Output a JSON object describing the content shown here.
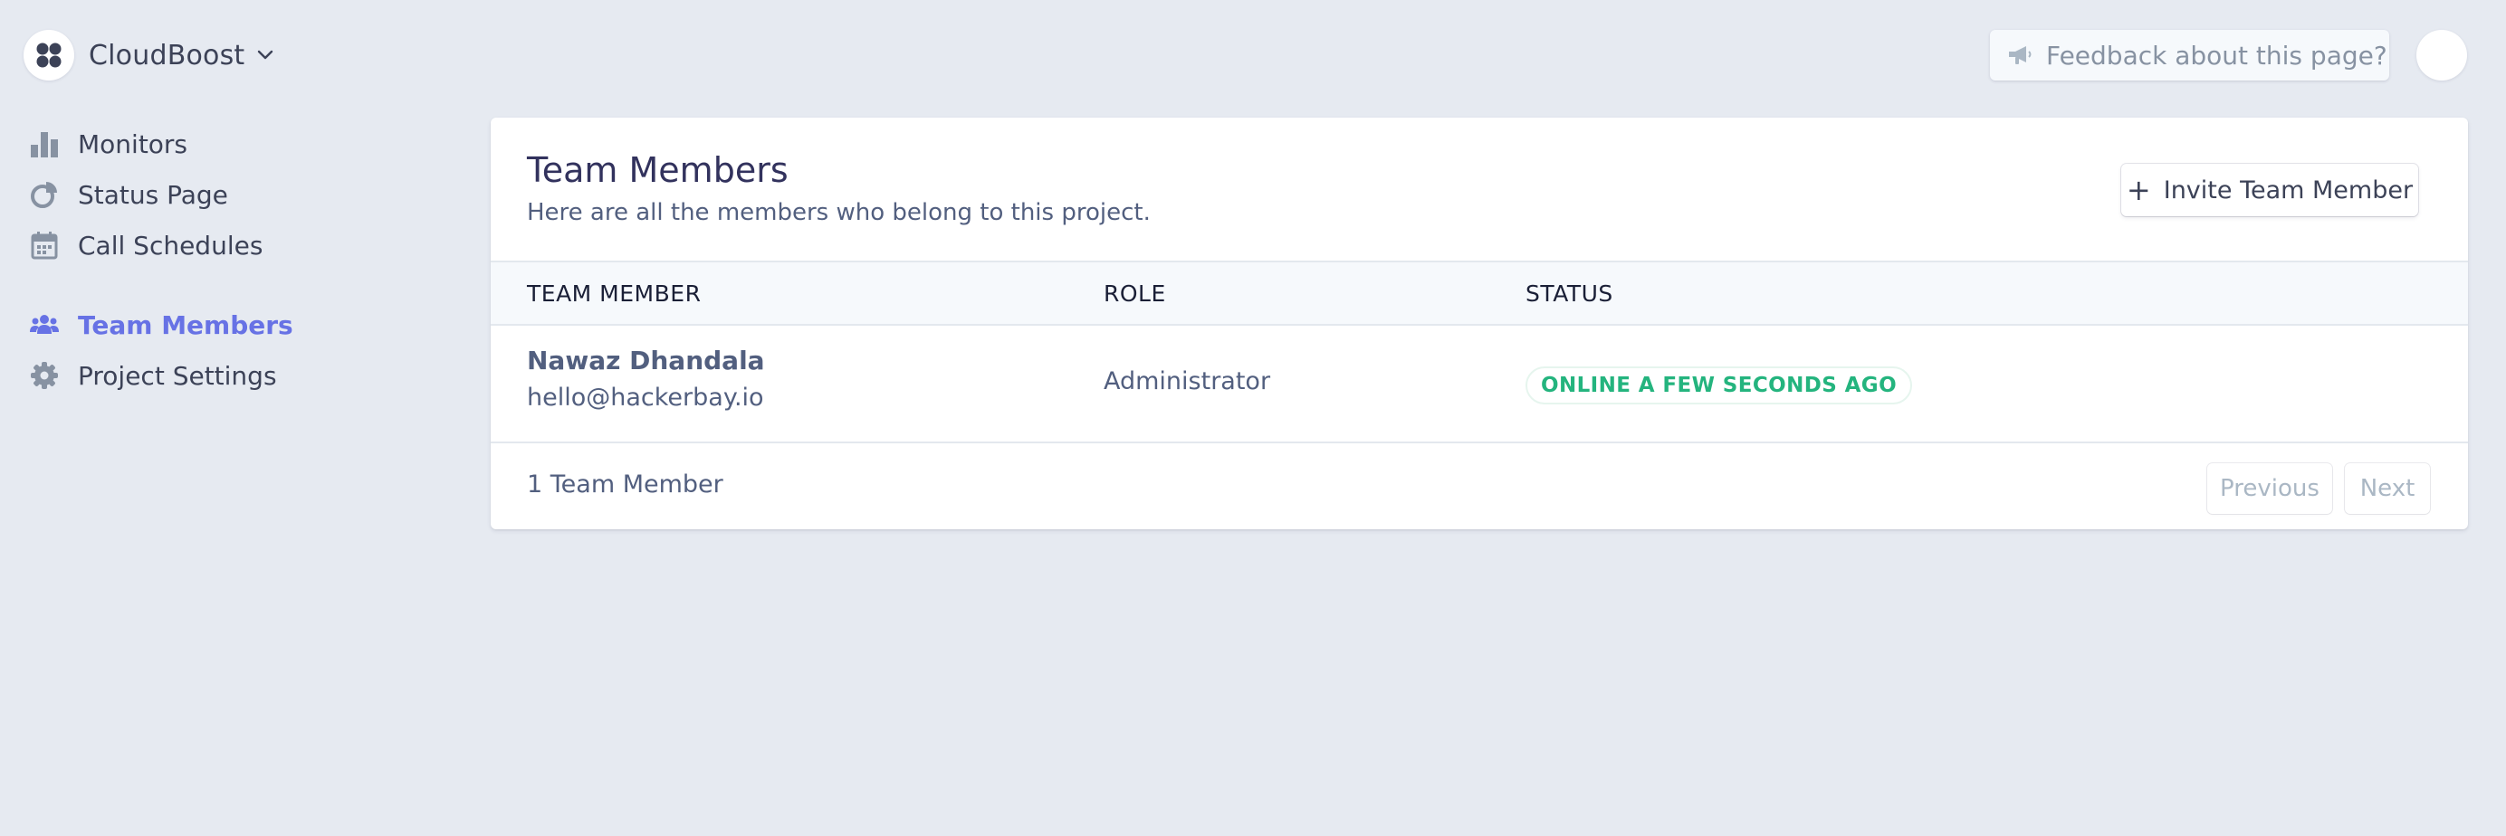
{
  "header": {
    "project_name": "CloudBoost",
    "feedback_placeholder": "Feedback about this page?"
  },
  "sidebar": {
    "items": [
      {
        "label": "Monitors",
        "icon": "bar-chart-icon"
      },
      {
        "label": "Status Page",
        "icon": "status-page-icon"
      },
      {
        "label": "Call Schedules",
        "icon": "calendar-icon"
      },
      {
        "label": "Team Members",
        "icon": "team-icon",
        "active": true
      },
      {
        "label": "Project Settings",
        "icon": "gear-icon"
      }
    ]
  },
  "main": {
    "title": "Team Members",
    "subtitle": "Here are all the members who belong to this project.",
    "invite_button": "Invite Team Member",
    "columns": [
      "TEAM MEMBER",
      "ROLE",
      "STATUS"
    ],
    "rows": [
      {
        "name": "Nawaz Dhandala",
        "email": "hello@hackerbay.io",
        "role": "Administrator",
        "status": "ONLINE A FEW SECONDS AGO"
      }
    ],
    "footer_count": "1 Team Member",
    "pagination": {
      "previous": "Previous",
      "next": "Next"
    }
  },
  "colors": {
    "background": "#e6eaf1",
    "accent": "#6772e5",
    "status_online": "#24b47e",
    "text": "#3c4257",
    "muted": "#8792a2"
  }
}
